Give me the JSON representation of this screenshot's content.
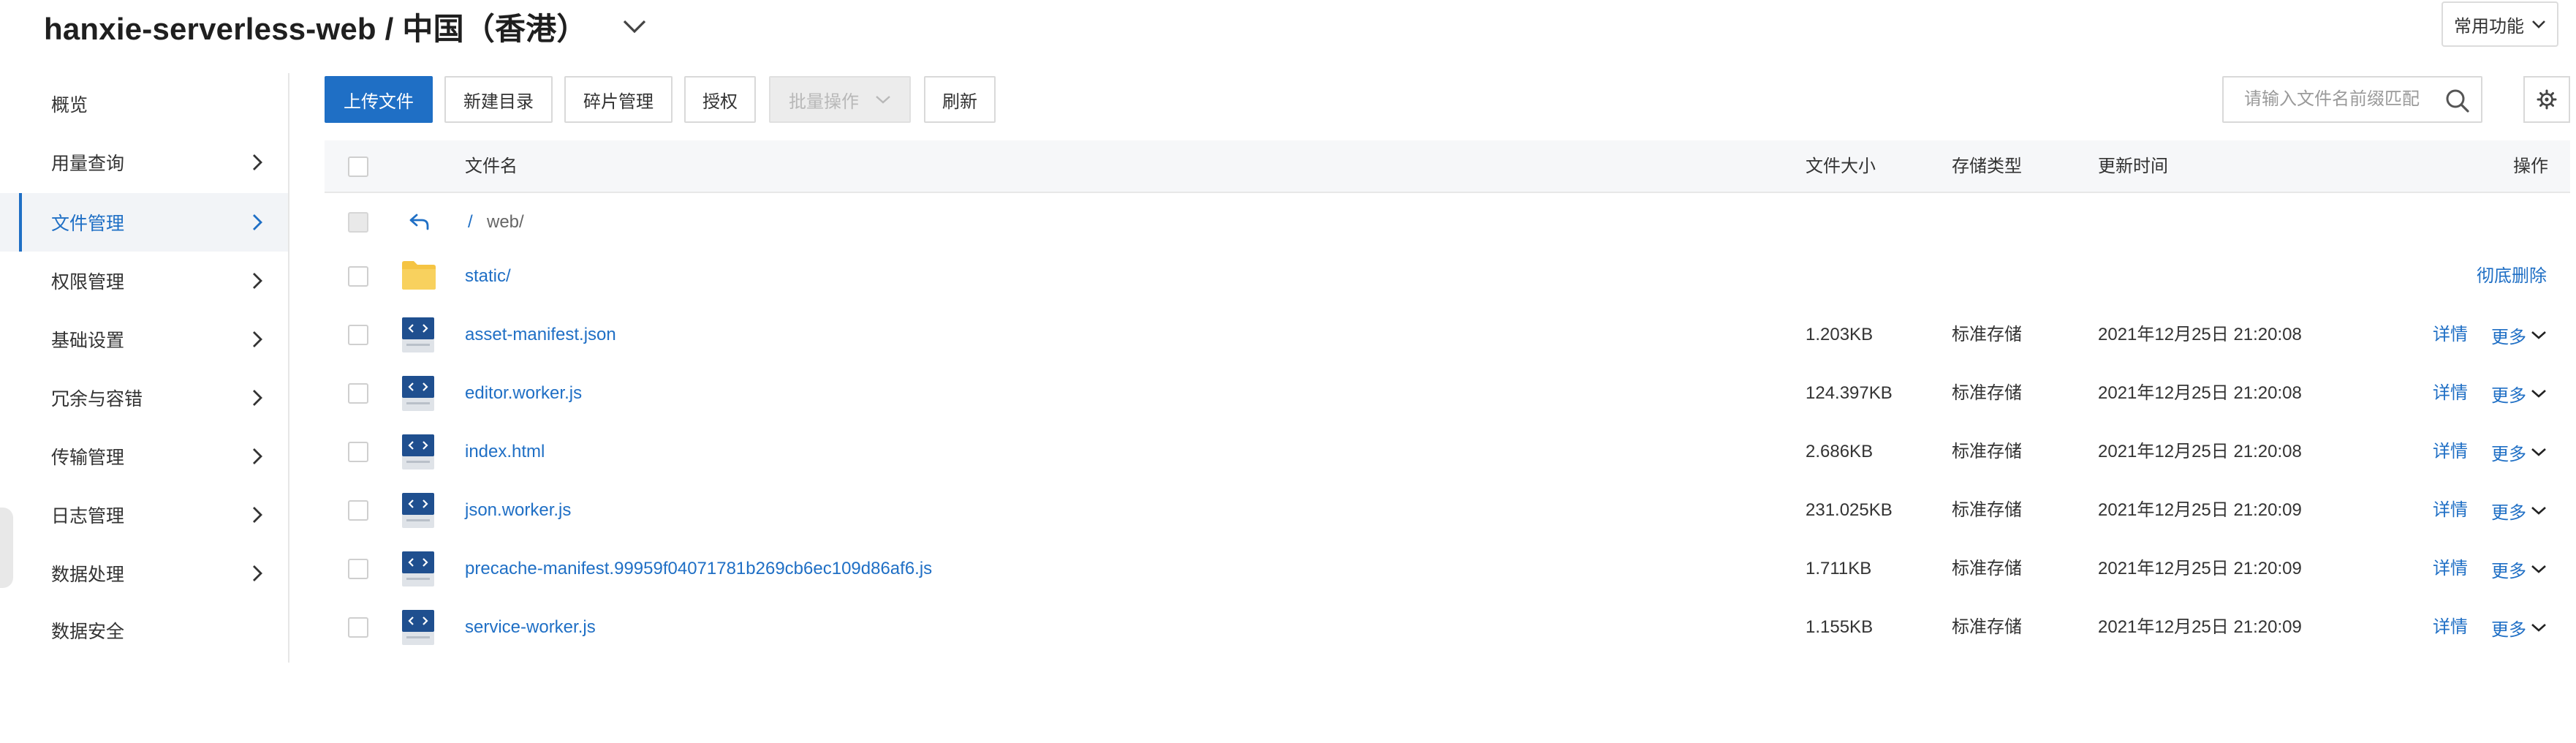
{
  "header": {
    "title": "hanxie-serverless-web / 中国（香港）",
    "common_functions": "常用功能"
  },
  "sidebar": {
    "items": [
      {
        "label": "概览"
      },
      {
        "label": "用量查询"
      },
      {
        "label": "文件管理"
      },
      {
        "label": "权限管理"
      },
      {
        "label": "基础设置"
      },
      {
        "label": "冗余与容错"
      },
      {
        "label": "传输管理"
      },
      {
        "label": "日志管理"
      },
      {
        "label": "数据处理"
      },
      {
        "label": "数据安全"
      }
    ],
    "active_index": 2
  },
  "toolbar": {
    "upload": "上传文件",
    "new_dir": "新建目录",
    "fragments": "碎片管理",
    "authorize": "授权",
    "batch": "批量操作",
    "refresh": "刷新",
    "search_placeholder": "请输入文件名前缀匹配"
  },
  "table": {
    "columns": {
      "name": "文件名",
      "size": "文件大小",
      "storage": "存储类型",
      "updated": "更新时间",
      "actions": "操作"
    },
    "path": {
      "root": "/",
      "dir": "web/"
    },
    "folder": {
      "name": "static/",
      "action": "彻底删除"
    },
    "files": [
      {
        "name": "asset-manifest.json",
        "size": "1.203KB",
        "storage": "标准存储",
        "updated": "2021年12月25日 21:20:08",
        "detail": "详情",
        "more": "更多"
      },
      {
        "name": "editor.worker.js",
        "size": "124.397KB",
        "storage": "标准存储",
        "updated": "2021年12月25日 21:20:08",
        "detail": "详情",
        "more": "更多"
      },
      {
        "name": "index.html",
        "size": "2.686KB",
        "storage": "标准存储",
        "updated": "2021年12月25日 21:20:08",
        "detail": "详情",
        "more": "更多"
      },
      {
        "name": "json.worker.js",
        "size": "231.025KB",
        "storage": "标准存储",
        "updated": "2021年12月25日 21:20:09",
        "detail": "详情",
        "more": "更多"
      },
      {
        "name": "precache-manifest.99959f04071781b269cb6ec109d86af6.js",
        "size": "1.711KB",
        "storage": "标准存储",
        "updated": "2021年12月25日 21:20:09",
        "detail": "详情",
        "more": "更多"
      },
      {
        "name": "service-worker.js",
        "size": "1.155KB",
        "storage": "标准存储",
        "updated": "2021年12月25日 21:20:09",
        "detail": "详情",
        "more": "更多"
      }
    ]
  },
  "colors": {
    "accent": "#1f6fc5",
    "folder": "#f5c443",
    "file_icon": "#1f4f8f"
  }
}
